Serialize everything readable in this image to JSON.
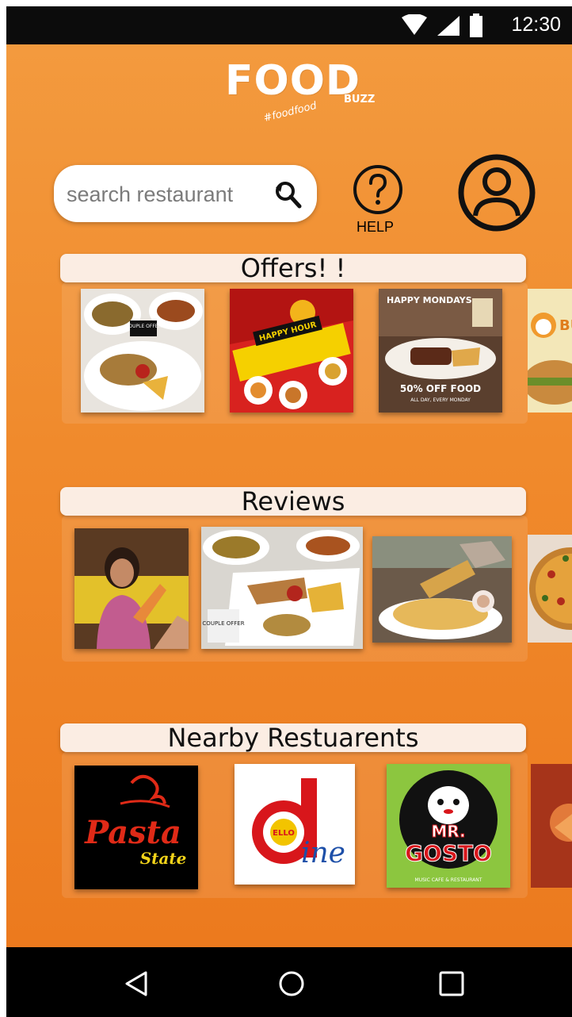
{
  "status_bar": {
    "time": "12:30",
    "icons": [
      "wifi-icon",
      "signal-icon",
      "battery-icon"
    ]
  },
  "app": {
    "logo": {
      "main": "FOOD",
      "sub": "BUZZ",
      "tagline": "#foodfood"
    },
    "search": {
      "placeholder": "search restaurant"
    },
    "help_label": "HELP"
  },
  "sections": {
    "offers": {
      "title": "Offers! !",
      "cards": [
        {
          "name": "offer-couple-offer",
          "text": "COUPLE OFFER"
        },
        {
          "name": "offer-happy-hour",
          "text": "HAPPY HOUR"
        },
        {
          "name": "offer-happy-mondays",
          "text": "HAPPY MONDAYS",
          "text2": "50% OFF FOOD",
          "text3": "ALL DAY, EVERY MONDAY"
        },
        {
          "name": "offer-burger-partial",
          "text": "BU"
        }
      ]
    },
    "reviews": {
      "title": "Reviews",
      "cards": [
        {
          "name": "review-photo-person"
        },
        {
          "name": "review-photo-platter",
          "text": "COUPLE OFFER"
        },
        {
          "name": "review-photo-biryani"
        },
        {
          "name": "review-photo-pizza-partial"
        }
      ]
    },
    "nearby": {
      "title": "Nearby Restuarents",
      "cards": [
        {
          "name": "restaurant-pasta-state",
          "text": "Pasta",
          "text2": "State"
        },
        {
          "name": "restaurant-hello-dine",
          "text": "ELLO",
          "text2": "ine"
        },
        {
          "name": "restaurant-mr-gosto",
          "text": "MR.",
          "text2": "GOSTO",
          "text3": "MUSIC CAFE & RESTAURANT"
        },
        {
          "name": "restaurant-partial"
        }
      ]
    }
  },
  "colors": {
    "background_top": "#f39a3e",
    "background_bottom": "#ec7a1e",
    "section_header": "#fbede3",
    "status_bar": "#0c0c0c",
    "nav_bar": "#000000"
  },
  "nav": {
    "icons": [
      "back-icon",
      "home-icon",
      "recents-icon"
    ]
  }
}
